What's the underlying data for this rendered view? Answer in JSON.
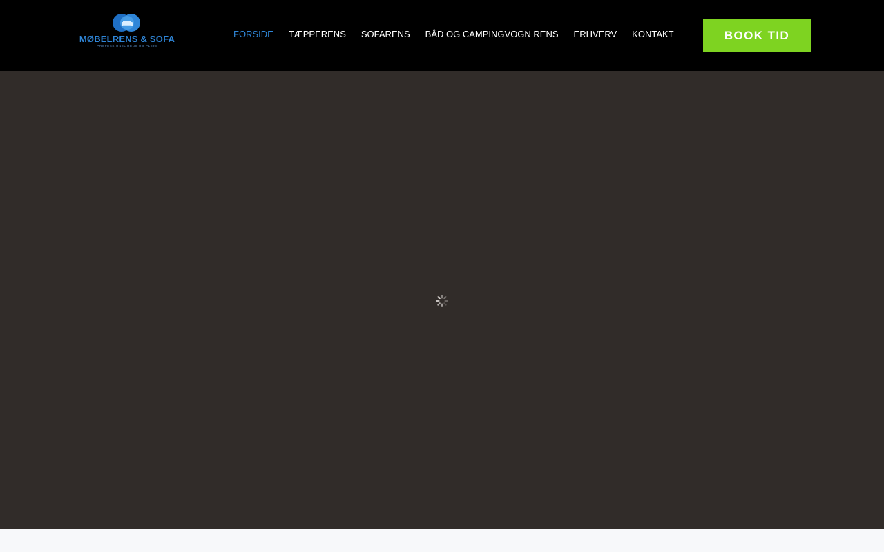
{
  "brand": {
    "name": "MØBELRENS & SOFA",
    "tagline": "PROFESSIONEL RENS OG PLEJE",
    "color": "#2f86d8"
  },
  "nav": {
    "items": [
      {
        "label": "FORSIDE",
        "active": true
      },
      {
        "label": "TÆPPERENS",
        "active": false
      },
      {
        "label": "SOFARENS",
        "active": false
      },
      {
        "label": "BÅD OG CAMPINGVOGN RENS",
        "active": false
      },
      {
        "label": "ERHVERV",
        "active": false
      },
      {
        "label": "KONTAKT",
        "active": false
      }
    ]
  },
  "cta": {
    "label": "BOOK TID",
    "color": "#7ed321"
  },
  "hero": {
    "background": "#312c29",
    "loading_icon": "spinner-icon"
  }
}
